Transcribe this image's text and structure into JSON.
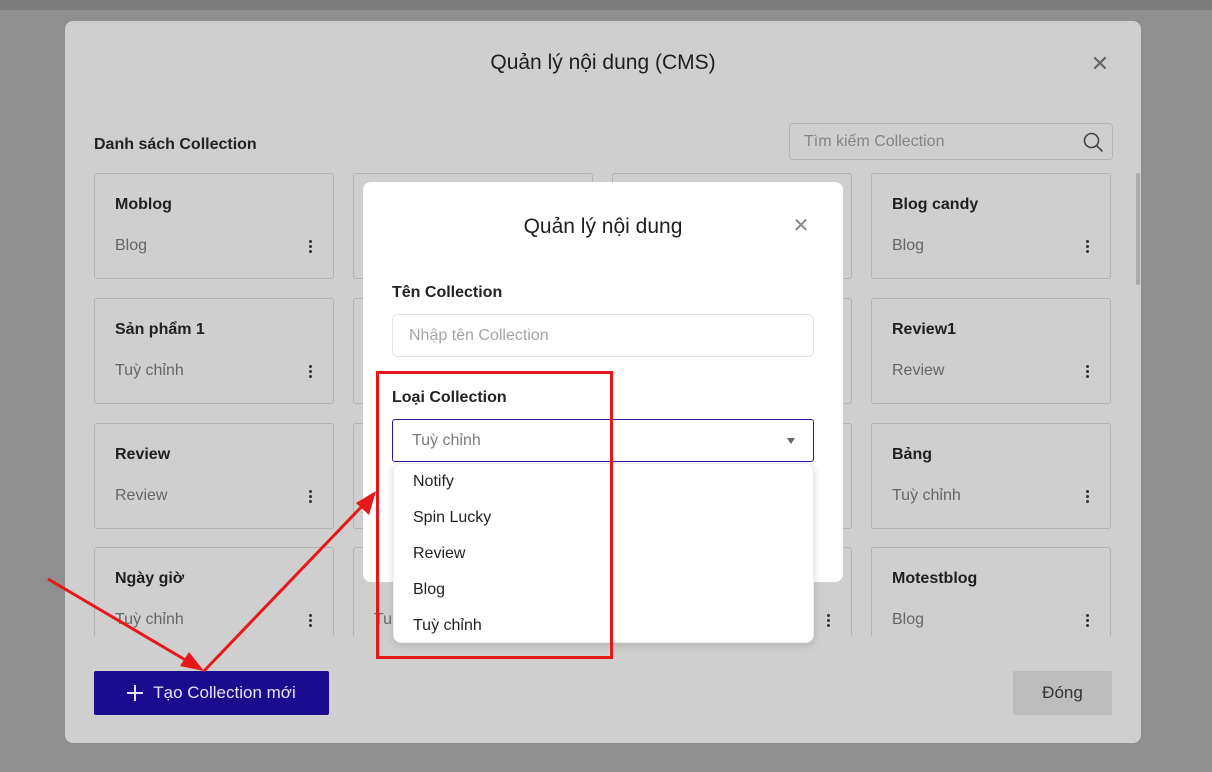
{
  "outer_modal": {
    "title": "Quản lý nội dung (CMS)",
    "list_label": "Danh sách Collection",
    "search_placeholder": "Tìm kiếm Collection",
    "create_button": "Tạo Collection mới",
    "close_button": "Đóng"
  },
  "collections": [
    {
      "name": "Moblog",
      "type": "Blog"
    },
    {
      "name": "",
      "type": ""
    },
    {
      "name": "",
      "type": ""
    },
    {
      "name": "Blog candy",
      "type": "Blog"
    },
    {
      "name": "Sản phẩm 1",
      "type": "Tuỳ chỉnh"
    },
    {
      "name": "",
      "type": ""
    },
    {
      "name": "",
      "type": ""
    },
    {
      "name": "Review1",
      "type": "Review"
    },
    {
      "name": "Review",
      "type": "Review"
    },
    {
      "name": "",
      "type": ""
    },
    {
      "name": "",
      "type": ""
    },
    {
      "name": "Bảng",
      "type": "Tuỳ chỉnh"
    },
    {
      "name": "Ngày giờ",
      "type": "Tuỳ chỉnh"
    },
    {
      "name": "",
      "type": "Tu"
    },
    {
      "name": "",
      "type": ""
    },
    {
      "name": "Motestblog",
      "type": "Blog"
    }
  ],
  "inner_modal": {
    "title": "Quản lý nội dung",
    "name_label": "Tên Collection",
    "name_placeholder": "Nhập tên Collection",
    "type_label": "Loại Collection",
    "type_selected": "Tuỳ chỉnh"
  },
  "type_options": [
    "Notify",
    "Spin Lucky",
    "Review",
    "Blog",
    "Tuỳ chỉnh"
  ],
  "colors": {
    "primary": "#1a0b8f",
    "annotation": "#e8171a"
  }
}
